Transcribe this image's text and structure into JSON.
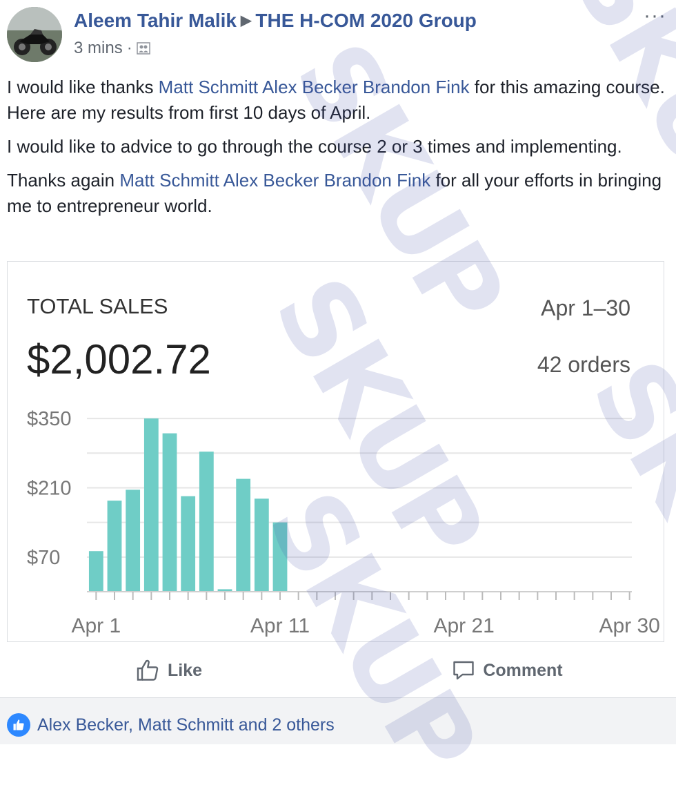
{
  "post": {
    "author": "Aleem Tahir Malik",
    "group": "THE H-COM 2020 Group",
    "time": "3 mins",
    "separator": "·",
    "more": "···",
    "paragraph1_a": "I would like thanks ",
    "paragraph1_mentions": [
      "Matt Schmitt",
      "Alex Becker",
      "Brandon Fink"
    ],
    "paragraph1_b": " for this amazing course. Here are my results from first 10 days of April.",
    "paragraph2": "I would like to advice to go through the course 2 or 3 times and implementing.",
    "paragraph3_a": "Thanks again ",
    "paragraph3_mentions": [
      "Matt Schmitt",
      "Alex Becker",
      "Brandon Fink"
    ],
    "paragraph3_b": " for all your efforts in bringing me to entrepreneur world."
  },
  "actions": {
    "like": "Like",
    "comment": "Comment"
  },
  "reactions": {
    "text": "Alex Becker, Matt Schmitt and 2 others"
  },
  "watermark": {
    "text": "SKUP"
  },
  "colors": {
    "link": "#385898",
    "bar": "#6fcdc6",
    "bar_dark": "#4aa3b8",
    "grid": "#e6e6e6"
  },
  "chart_data": {
    "type": "bar",
    "title": "TOTAL SALES",
    "total": "$2,002.72",
    "date_range": "Apr 1–30",
    "orders": "42 orders",
    "y_ticks": [
      "$350",
      "$210",
      "$70"
    ],
    "y_tick_values": [
      350,
      210,
      70
    ],
    "ylim": [
      0,
      385
    ],
    "x_tick_labels": [
      "Apr 1",
      "Apr 11",
      "Apr 21",
      "Apr 30"
    ],
    "x_tick_days": [
      1,
      11,
      21,
      30
    ],
    "categories": [
      "Apr 1",
      "Apr 2",
      "Apr 3",
      "Apr 4",
      "Apr 5",
      "Apr 6",
      "Apr 7",
      "Apr 8",
      "Apr 9",
      "Apr 10",
      "Apr 11",
      "Apr 12",
      "Apr 13",
      "Apr 14",
      "Apr 15",
      "Apr 16",
      "Apr 17",
      "Apr 18",
      "Apr 19",
      "Apr 20",
      "Apr 21",
      "Apr 22",
      "Apr 23",
      "Apr 24",
      "Apr 25",
      "Apr 26",
      "Apr 27",
      "Apr 28",
      "Apr 29",
      "Apr 30"
    ],
    "values": [
      82,
      184,
      206,
      350,
      320,
      193,
      283,
      5,
      228,
      188,
      140,
      0,
      0,
      0,
      0,
      0,
      0,
      0,
      0,
      0,
      0,
      0,
      0,
      0,
      0,
      0,
      0,
      0,
      0,
      0
    ],
    "grid": true
  }
}
